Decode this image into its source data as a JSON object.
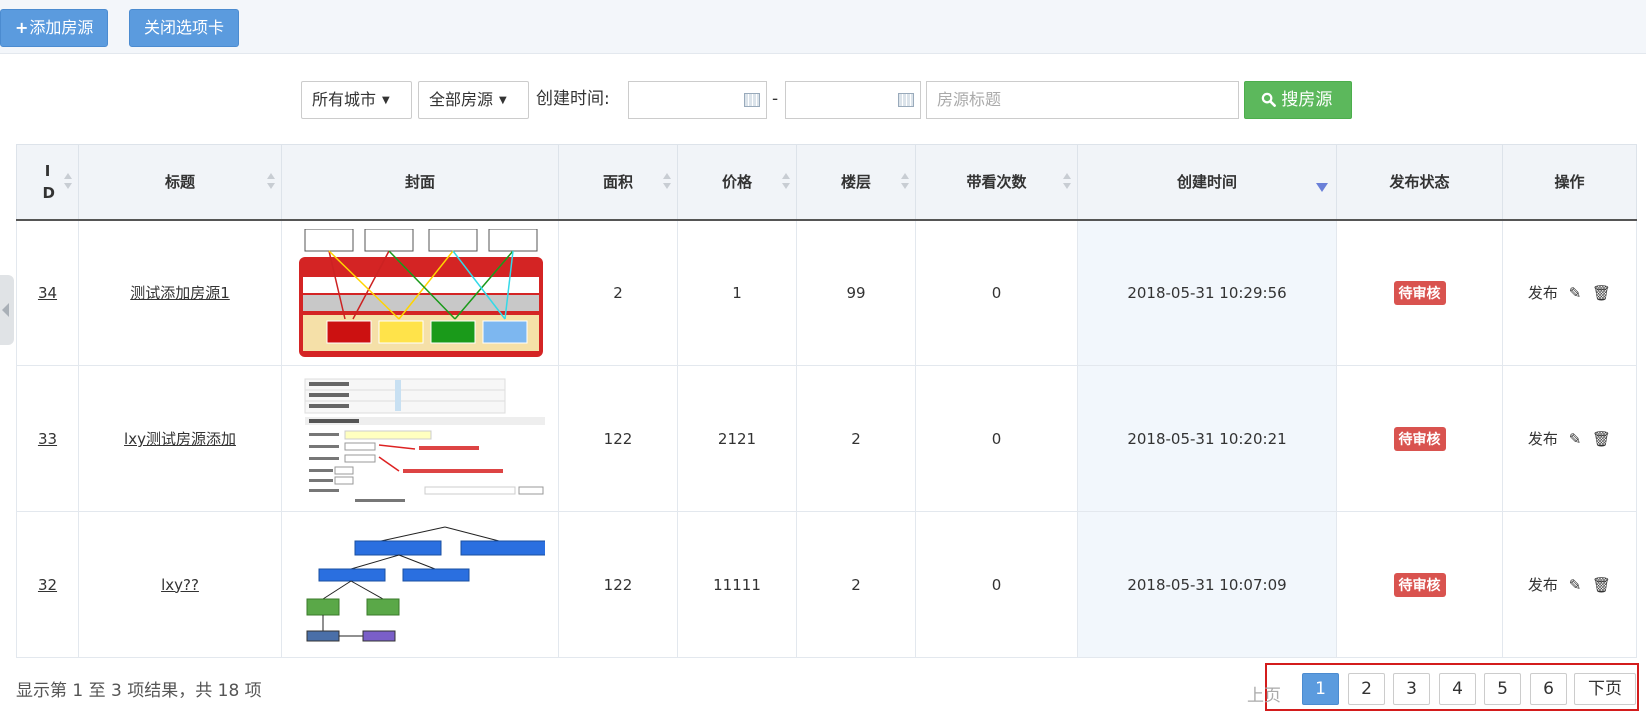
{
  "toolbar": {
    "add_label": "添加房源",
    "add_plus": "+",
    "close_label": "关闭选项卡"
  },
  "filters": {
    "city": "所有城市",
    "source": "全部房源",
    "created_label": "创建时间:",
    "date_sep": "-",
    "title_placeholder": "房源标题",
    "search_label": "搜房源"
  },
  "table": {
    "headers": {
      "id": "ID",
      "title": "标题",
      "cover": "封面",
      "area": "面积",
      "price": "价格",
      "floor": "楼层",
      "views": "带看次数",
      "created": "创建时间",
      "status": "发布状态",
      "ops": "操作"
    },
    "rows": [
      {
        "id": "34",
        "title": "测试添加房源1",
        "area": "2",
        "price": "1",
        "floor": "99",
        "views": "0",
        "created": "2018-05-31 10:29:56",
        "status": "待审核",
        "publish": "发布"
      },
      {
        "id": "33",
        "title": "lxy测试房源添加",
        "area": "122",
        "price": "2121",
        "floor": "2",
        "views": "0",
        "created": "2018-05-31 10:20:21",
        "status": "待审核",
        "publish": "发布"
      },
      {
        "id": "32",
        "title": "lxy??",
        "area": "122",
        "price": "11111",
        "floor": "2",
        "views": "0",
        "created": "2018-05-31 10:07:09",
        "status": "待审核",
        "publish": "发布"
      }
    ]
  },
  "footer": {
    "info": "显示第 1 至 3 项结果，共 18 项"
  },
  "pager": {
    "prev": "上页",
    "pages": [
      "1",
      "2",
      "3",
      "4",
      "5",
      "6"
    ],
    "next": "下页",
    "active": "1"
  },
  "colors": {
    "primary": "#5b9bde",
    "success": "#5cb85c",
    "danger": "#d9534f",
    "highlight_border": "#d31c1c"
  }
}
